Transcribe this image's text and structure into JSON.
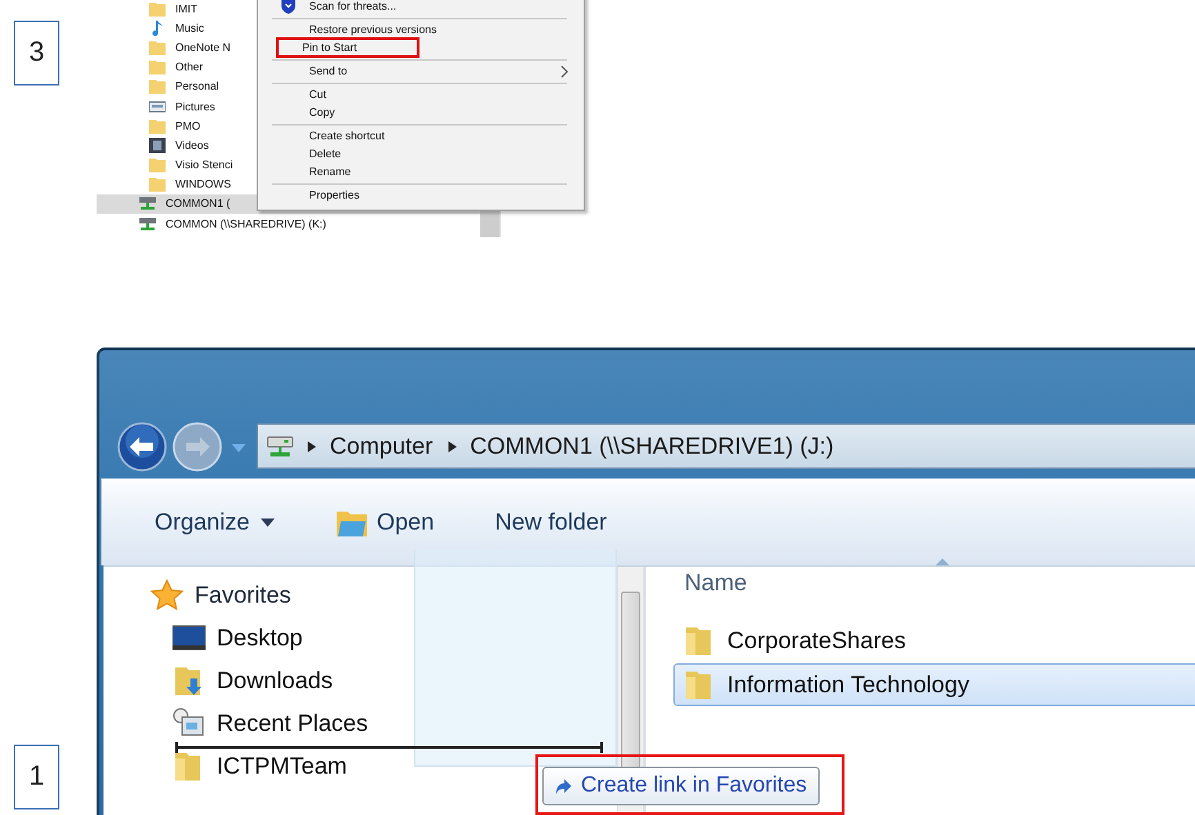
{
  "top_explorer": {
    "step": "3",
    "nav_items": [
      {
        "label": "IMIT",
        "kind": "folder",
        "selected": false
      },
      {
        "label": "Music",
        "kind": "music",
        "selected": false
      },
      {
        "label": "OneNote N",
        "kind": "folder",
        "selected": false
      },
      {
        "label": "Other",
        "kind": "folder",
        "selected": false
      },
      {
        "label": "Personal",
        "kind": "folder",
        "selected": false
      },
      {
        "label": "Pictures",
        "kind": "pictures",
        "selected": false
      },
      {
        "label": "PMO",
        "kind": "folder",
        "selected": false
      },
      {
        "label": "Videos",
        "kind": "videos",
        "selected": false
      },
      {
        "label": "Visio Stenci",
        "kind": "folder",
        "selected": false
      },
      {
        "label": "WINDOWS",
        "kind": "folder",
        "selected": false
      },
      {
        "label": "COMMON1 (",
        "kind": "drive",
        "selected": true
      },
      {
        "label": "COMMON (\\\\SHAREDRIVE) (K:)",
        "kind": "drive",
        "selected": false
      }
    ],
    "context_menu": [
      [
        {
          "label": "Scan for threats...",
          "kind": "shield",
          "highlighted": false,
          "submenu": false
        }
      ],
      [
        {
          "label": "Restore previous versions",
          "kind": "plain",
          "highlighted": false,
          "submenu": false
        },
        {
          "label": "Pin to Start",
          "kind": "plain",
          "highlighted": true,
          "submenu": false
        }
      ],
      [
        {
          "label": "Send to",
          "kind": "plain",
          "highlighted": false,
          "submenu": true
        }
      ],
      [
        {
          "label": "Cut",
          "kind": "plain",
          "highlighted": false,
          "submenu": false
        },
        {
          "label": "Copy",
          "kind": "plain",
          "highlighted": false,
          "submenu": false
        }
      ],
      [
        {
          "label": "Create shortcut",
          "kind": "plain",
          "highlighted": false,
          "submenu": false
        },
        {
          "label": "Delete",
          "kind": "plain",
          "highlighted": false,
          "submenu": false
        },
        {
          "label": "Rename",
          "kind": "plain",
          "highlighted": false,
          "submenu": false
        }
      ],
      [
        {
          "label": "Properties",
          "kind": "plain",
          "highlighted": false,
          "submenu": false
        }
      ]
    ]
  },
  "bottom_explorer": {
    "step": "1",
    "address": [
      "Computer",
      "COMMON1 (\\\\SHAREDRIVE1) (J:)"
    ],
    "toolbar": [
      {
        "label": "Organize",
        "kind": "menu"
      },
      {
        "label": "Open",
        "kind": "icon"
      },
      {
        "label": "New folder",
        "kind": "plain"
      }
    ],
    "favorites": {
      "label": "Favorites",
      "items": [
        {
          "label": "Desktop",
          "kind": "desktop"
        },
        {
          "label": "Downloads",
          "kind": "downloads"
        },
        {
          "label": "Recent Places",
          "kind": "recent"
        },
        {
          "label": "ICTPMTeam",
          "kind": "folder"
        }
      ]
    },
    "column": "Name",
    "files": [
      {
        "label": "CorporateShares",
        "selected": false
      },
      {
        "label": "Information Technology",
        "selected": true
      }
    ],
    "tooltip": {
      "label": "Create link in Favorites",
      "highlighted": true
    }
  }
}
